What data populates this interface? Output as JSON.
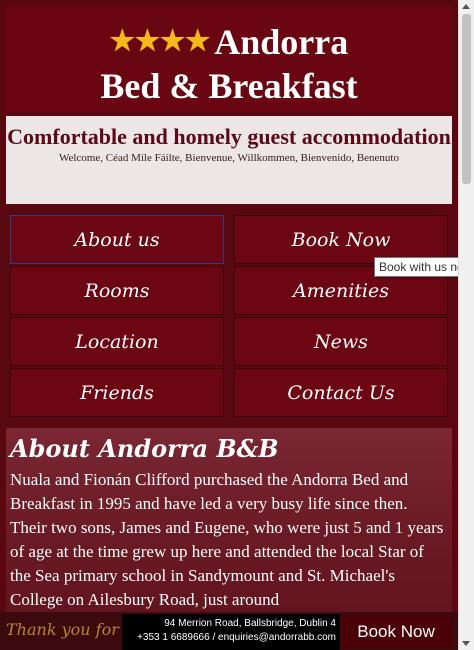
{
  "header": {
    "stars": "★★★★",
    "title_line1": "Andorra",
    "title_line2": "Bed & Breakfast"
  },
  "tagline": {
    "title": "Comfortable and homely guest accommodation",
    "welcome": "Welcome, Céad Míle Fáilte, Bienvenue, Willkommen, Bienvenido, Benenuto"
  },
  "nav": {
    "items": [
      {
        "label": "About us"
      },
      {
        "label": "Book Now"
      },
      {
        "label": "Rooms"
      },
      {
        "label": "Amenities"
      },
      {
        "label": "Location"
      },
      {
        "label": "News"
      },
      {
        "label": "Friends"
      },
      {
        "label": "Contact Us"
      }
    ],
    "tooltip": "Book with us now"
  },
  "about": {
    "heading": "About Andorra B&B",
    "text": "Nuala and Fionán Clifford purchased the Andorra Bed and Breakfast in 1995 and have led a very busy life since then. Their two sons, James and Eugene, who were just 5 and 1 years of age at the time grew up here and attended the local Star of the Sea primary school in Sandymount and St. Michael's College on Ailesbury Road, just around"
  },
  "footer": {
    "thanks": "Thank you for v",
    "address": "94 Merrion Road, Ballsbridge, Dublin 4",
    "contact": "+353 1 6689666 / enquiries@andorrabb.com",
    "book_label": "Book Now"
  },
  "colors": {
    "brand": "#6a0611",
    "star": "#f6b81b",
    "tagline_bg": "#ede6e6"
  }
}
